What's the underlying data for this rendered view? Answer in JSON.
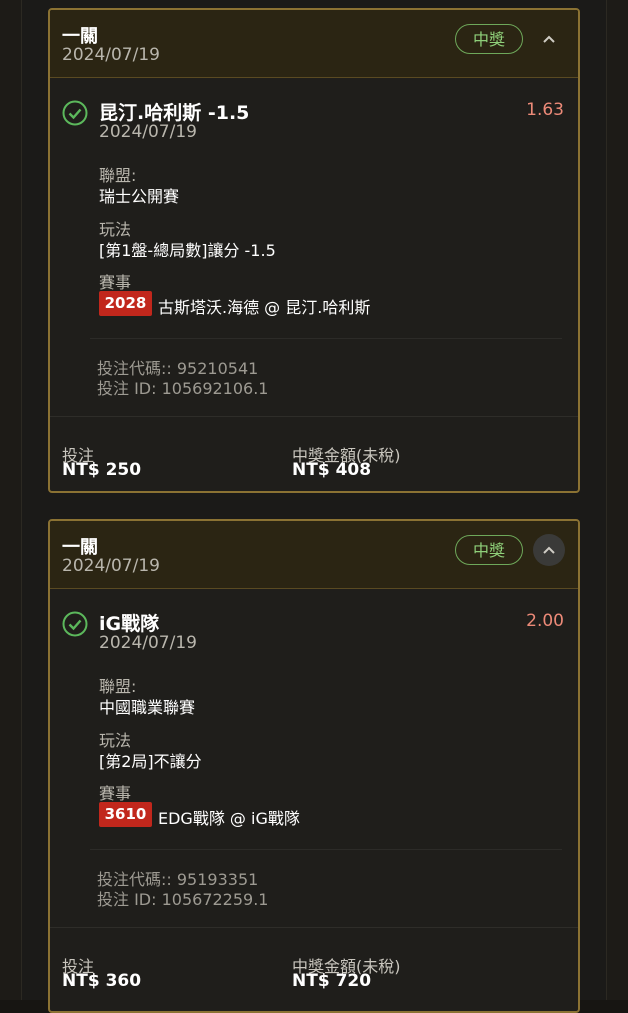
{
  "bets": [
    {
      "bet_type": "一關",
      "date": "2024/07/19",
      "status": "中獎",
      "collapse_icon": "chevron-up-icon",
      "selection": {
        "name": "昆汀.哈利斯 -1.5",
        "date": "2024/07/19",
        "odds": "1.63",
        "league_label": "聯盟:",
        "league": "瑞士公開賽",
        "market_label": "玩法",
        "market": "[第1盤-總局數]讓分 -1.5",
        "event_label": "賽事",
        "event_code": "2028",
        "event_name": "古斯塔沃.海德 @ 昆汀.哈利斯"
      },
      "bet_code": "投注代碼:: 95210541",
      "bet_id": "投注 ID: 105692106.1",
      "stake_label": "投注",
      "stake": "NT$ 250",
      "payout_label": "中獎金額(未稅)",
      "payout": "NT$ 408"
    },
    {
      "bet_type": "一關",
      "date": "2024/07/19",
      "status": "中獎",
      "collapse_icon": "chevron-up-icon",
      "selection": {
        "name": "iG戰隊",
        "date": "2024/07/19",
        "odds": "2.00",
        "league_label": "聯盟:",
        "league": "中國職業聯賽",
        "market_label": "玩法",
        "market": "[第2局]不讓分",
        "event_label": "賽事",
        "event_code": "3610",
        "event_name": "EDG戰隊 @ iG戰隊"
      },
      "bet_code": "投注代碼:: 95193351",
      "bet_id": "投注 ID: 105672259.1",
      "stake_label": "投注",
      "stake": "NT$ 360",
      "payout_label": "中獎金額(未稅)",
      "payout": "NT$ 720"
    }
  ],
  "colors": {
    "card_border": "#8b7233",
    "header_bg": "#2b2513",
    "win_green": "#8fd07a",
    "odds_red": "#ec8a78",
    "event_tag_red": "#c1271c"
  }
}
